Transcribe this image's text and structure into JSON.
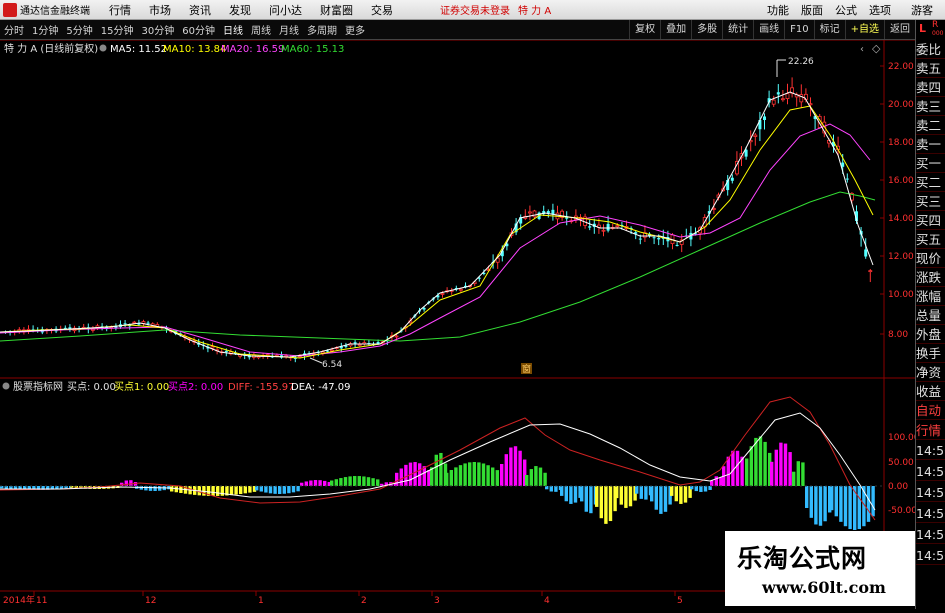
{
  "app": {
    "title": "通达信金融终端",
    "menus": [
      "行情",
      "市场",
      "资讯",
      "发现",
      "问小达",
      "财富圈",
      "交易"
    ],
    "status_msg": "证券交易未登录",
    "stock_tag": "特 力 A",
    "right_menus": [
      "功能",
      "版面",
      "公式",
      "选项"
    ],
    "guest_label": "游客"
  },
  "toolbar": {
    "periods": [
      "分时",
      "1分钟",
      "5分钟",
      "15分钟",
      "30分钟",
      "60分钟",
      "日线",
      "周线",
      "月线",
      "多周期",
      "更多"
    ],
    "active_period": "日线",
    "right_buttons": [
      "复权",
      "叠加",
      "多股",
      "统计",
      "画线",
      "F10",
      "标记",
      "+自选",
      "返回"
    ]
  },
  "main_chart": {
    "legend": {
      "stock": "特 力 A (日线前复权)",
      "ma5": "MA5: 11.52",
      "ma10": "MA10: 13.84",
      "ma20": "MA20: 16.59",
      "ma60": "MA60: 15.13"
    },
    "colors": {
      "ma5": "#ffffff",
      "ma10": "#ffff00",
      "ma20": "#ff44ff",
      "ma60": "#33dd33",
      "up": "#ff3232",
      "down": "#54ffff"
    },
    "y_ticks": [
      "22.00",
      "20.00",
      "18.00",
      "16.00",
      "14.00",
      "12.00",
      "10.00",
      "8.00"
    ],
    "high_label": "22.26",
    "low_label": "6.54",
    "event_marker": "窗"
  },
  "indicator": {
    "name": "股票指标网",
    "buy_point": "买点: 0.00",
    "buy_point1": "买点1: 0.00",
    "buy_point2": "买点2: 0.00",
    "diff": "DIFF: -155.97",
    "dea": "DEA: -47.09",
    "y_ticks": [
      "100.00",
      "50.00",
      "0.00",
      "-50.00"
    ],
    "colors": {
      "magenta": "#ff00ff",
      "green": "#33dd33",
      "yellow": "#ffff33",
      "cyan": "#33bbff",
      "diff": "#ff4040",
      "dea": "#ffffff"
    }
  },
  "x_axis": {
    "labels": [
      "2014年",
      "11",
      "12",
      "1",
      "2",
      "3",
      "4",
      "5"
    ]
  },
  "right_panel": {
    "header_l": "L",
    "header_r": "R",
    "header_i": "000",
    "items": [
      "委比",
      "卖五",
      "卖四",
      "卖三",
      "卖二",
      "卖一",
      "买一",
      "买二",
      "买三",
      "买四",
      "买五",
      "现价",
      "涨跌",
      "涨幅",
      "总量",
      "外盘",
      "换手",
      "净资",
      "收益",
      "自动",
      "行情",
      "14:50",
      "14:50",
      "14:50",
      "14:50",
      "14:50",
      "14:50"
    ]
  },
  "watermark": {
    "title": "乐淘公式网",
    "url": "www.60lt.com"
  }
}
